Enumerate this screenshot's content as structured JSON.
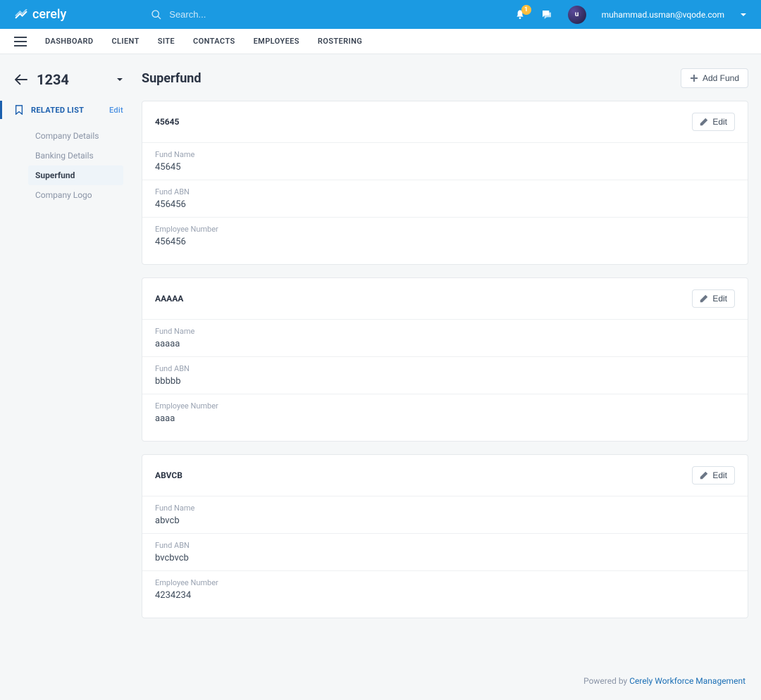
{
  "header": {
    "brand": "cerely",
    "search_placeholder": "Search...",
    "notif_count": "1",
    "user_email": "muhammad.usman@vqode.com",
    "avatar_letter": "u"
  },
  "nav": {
    "items": [
      "DASHBOARD",
      "CLIENT",
      "SITE",
      "CONTACTS",
      "EMPLOYEES",
      "ROSTERING"
    ]
  },
  "sidebar": {
    "breadcrumb_title": "1234",
    "section_label": "RELATED LIST",
    "edit_label": "Edit",
    "items": [
      {
        "label": "Company Details",
        "active": false
      },
      {
        "label": "Banking Details",
        "active": false
      },
      {
        "label": "Superfund",
        "active": true
      },
      {
        "label": "Company Logo",
        "active": false
      }
    ]
  },
  "main": {
    "title": "Superfund",
    "add_label": "Add Fund",
    "edit_label": "Edit",
    "field_labels": {
      "fund_name": "Fund Name",
      "fund_abn": "Fund ABN",
      "employee_number": "Employee Number"
    },
    "cards": [
      {
        "title": "45645",
        "fund_name": "45645",
        "fund_abn": "456456",
        "employee_number": "456456"
      },
      {
        "title": "AAAAA",
        "fund_name": "aaaaa",
        "fund_abn": "bbbbb",
        "employee_number": "aaaa"
      },
      {
        "title": "ABVCB",
        "fund_name": "abvcb",
        "fund_abn": "bvcbvcb",
        "employee_number": "4234234"
      }
    ]
  },
  "footer": {
    "prefix": "Powered by ",
    "link": "Cerely Workforce Management"
  }
}
